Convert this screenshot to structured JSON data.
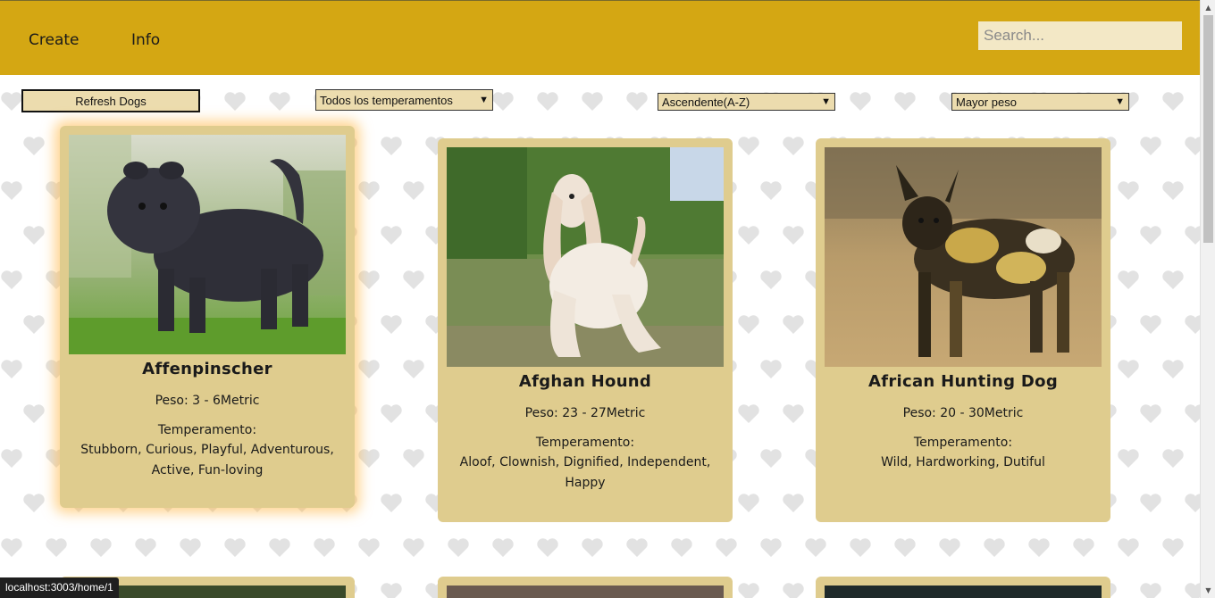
{
  "nav": {
    "links": [
      {
        "label": "Create"
      },
      {
        "label": "Info"
      }
    ],
    "search_placeholder": "Search..."
  },
  "filters": {
    "refresh_label": "Refresh Dogs",
    "temperament_selected": "Todos los temperamentos",
    "order_selected": "Ascendente(A-Z)",
    "weight_selected": "Mayor peso"
  },
  "cards": [
    {
      "name": "Affenpinscher",
      "weight": "Peso: 3 - 6Metric",
      "temperament_label": "Temperamento:",
      "temperament": "Stubborn, Curious, Playful, Adventurous, Active, Fun-loving",
      "image_icon": "dog-photo-affenpinscher"
    },
    {
      "name": "Afghan Hound",
      "weight": "Peso: 23 - 27Metric",
      "temperament_label": "Temperamento:",
      "temperament": "Aloof, Clownish, Dignified, Independent, Happy",
      "image_icon": "dog-photo-afghan-hound"
    },
    {
      "name": "African Hunting Dog",
      "weight": "Peso: 20 - 30Metric",
      "temperament_label": "Temperamento:",
      "temperament": "Wild, Hardworking, Dutiful",
      "image_icon": "dog-photo-african-hunting-dog"
    }
  ],
  "status_url": "localhost:3003/home/1",
  "colors": {
    "header": "#d4a713",
    "card": "#dfcc8e",
    "control": "#ecdcae",
    "search_bg": "#f3e8c6"
  }
}
